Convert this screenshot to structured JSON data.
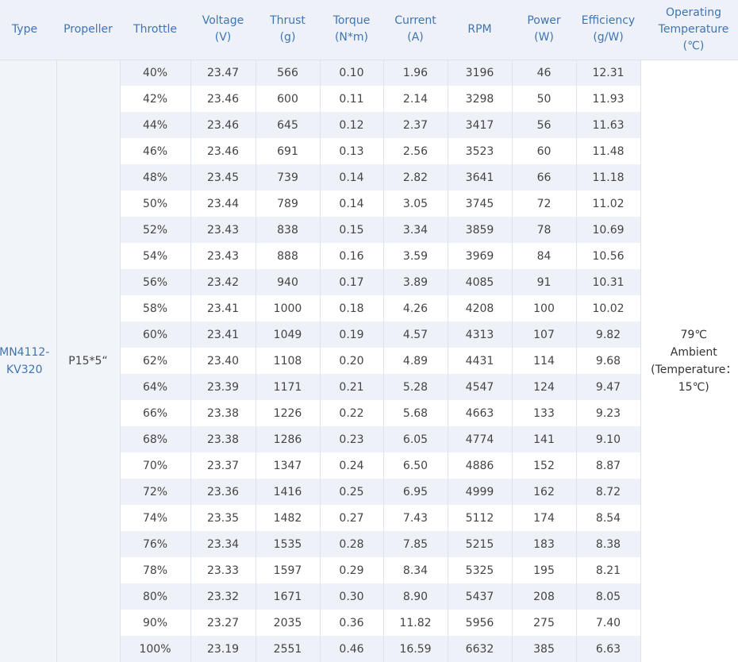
{
  "headers": [
    {
      "key": "type",
      "lines": [
        "Type"
      ]
    },
    {
      "key": "propeller",
      "lines": [
        "Propeller"
      ]
    },
    {
      "key": "throttle",
      "lines": [
        "Throttle"
      ]
    },
    {
      "key": "voltage",
      "lines": [
        "Voltage",
        "(V)"
      ]
    },
    {
      "key": "thrust",
      "lines": [
        "Thrust",
        "(g)"
      ]
    },
    {
      "key": "torque",
      "lines": [
        "Torque",
        "(N*m)"
      ]
    },
    {
      "key": "current",
      "lines": [
        "Current",
        "(A)"
      ]
    },
    {
      "key": "rpm",
      "lines": [
        "RPM"
      ]
    },
    {
      "key": "power",
      "lines": [
        "Power",
        "(W)"
      ]
    },
    {
      "key": "efficiency",
      "lines": [
        "Efficiency",
        "(g/W)"
      ]
    },
    {
      "key": "temperature",
      "lines": [
        "Operating",
        "Temperature",
        "(℃)"
      ]
    }
  ],
  "type_lines": [
    "MN4112-",
    "KV320"
  ],
  "propeller": "P15*5“",
  "temperature_lines": [
    "79℃",
    "Ambient",
    "(Temperature：",
    "15℃)"
  ],
  "rows": [
    [
      "40%",
      "23.47",
      "566",
      "0.10",
      "1.96",
      "3196",
      "46",
      "12.31"
    ],
    [
      "42%",
      "23.46",
      "600",
      "0.11",
      "2.14",
      "3298",
      "50",
      "11.93"
    ],
    [
      "44%",
      "23.46",
      "645",
      "0.12",
      "2.37",
      "3417",
      "56",
      "11.63"
    ],
    [
      "46%",
      "23.46",
      "691",
      "0.13",
      "2.56",
      "3523",
      "60",
      "11.48"
    ],
    [
      "48%",
      "23.45",
      "739",
      "0.14",
      "2.82",
      "3641",
      "66",
      "11.18"
    ],
    [
      "50%",
      "23.44",
      "789",
      "0.14",
      "3.05",
      "3745",
      "72",
      "11.02"
    ],
    [
      "52%",
      "23.43",
      "838",
      "0.15",
      "3.34",
      "3859",
      "78",
      "10.69"
    ],
    [
      "54%",
      "23.43",
      "888",
      "0.16",
      "3.59",
      "3969",
      "84",
      "10.56"
    ],
    [
      "56%",
      "23.42",
      "940",
      "0.17",
      "3.89",
      "4085",
      "91",
      "10.31"
    ],
    [
      "58%",
      "23.41",
      "1000",
      "0.18",
      "4.26",
      "4208",
      "100",
      "10.02"
    ],
    [
      "60%",
      "23.41",
      "1049",
      "0.19",
      "4.57",
      "4313",
      "107",
      "9.82"
    ],
    [
      "62%",
      "23.40",
      "1108",
      "0.20",
      "4.89",
      "4431",
      "114",
      "9.68"
    ],
    [
      "64%",
      "23.39",
      "1171",
      "0.21",
      "5.28",
      "4547",
      "124",
      "9.47"
    ],
    [
      "66%",
      "23.38",
      "1226",
      "0.22",
      "5.68",
      "4663",
      "133",
      "9.23"
    ],
    [
      "68%",
      "23.38",
      "1286",
      "0.23",
      "6.05",
      "4774",
      "141",
      "9.10"
    ],
    [
      "70%",
      "23.37",
      "1347",
      "0.24",
      "6.50",
      "4886",
      "152",
      "8.87"
    ],
    [
      "72%",
      "23.36",
      "1416",
      "0.25",
      "6.95",
      "4999",
      "162",
      "8.72"
    ],
    [
      "74%",
      "23.35",
      "1482",
      "0.27",
      "7.43",
      "5112",
      "174",
      "8.54"
    ],
    [
      "76%",
      "23.34",
      "1535",
      "0.28",
      "7.85",
      "5215",
      "183",
      "8.38"
    ],
    [
      "78%",
      "23.33",
      "1597",
      "0.29",
      "8.34",
      "5325",
      "195",
      "8.21"
    ],
    [
      "80%",
      "23.32",
      "1671",
      "0.30",
      "8.90",
      "5437",
      "208",
      "8.05"
    ],
    [
      "90%",
      "23.27",
      "2035",
      "0.36",
      "11.82",
      "5956",
      "275",
      "7.40"
    ],
    [
      "100%",
      "23.19",
      "2551",
      "0.46",
      "16.59",
      "6632",
      "385",
      "6.63"
    ]
  ]
}
